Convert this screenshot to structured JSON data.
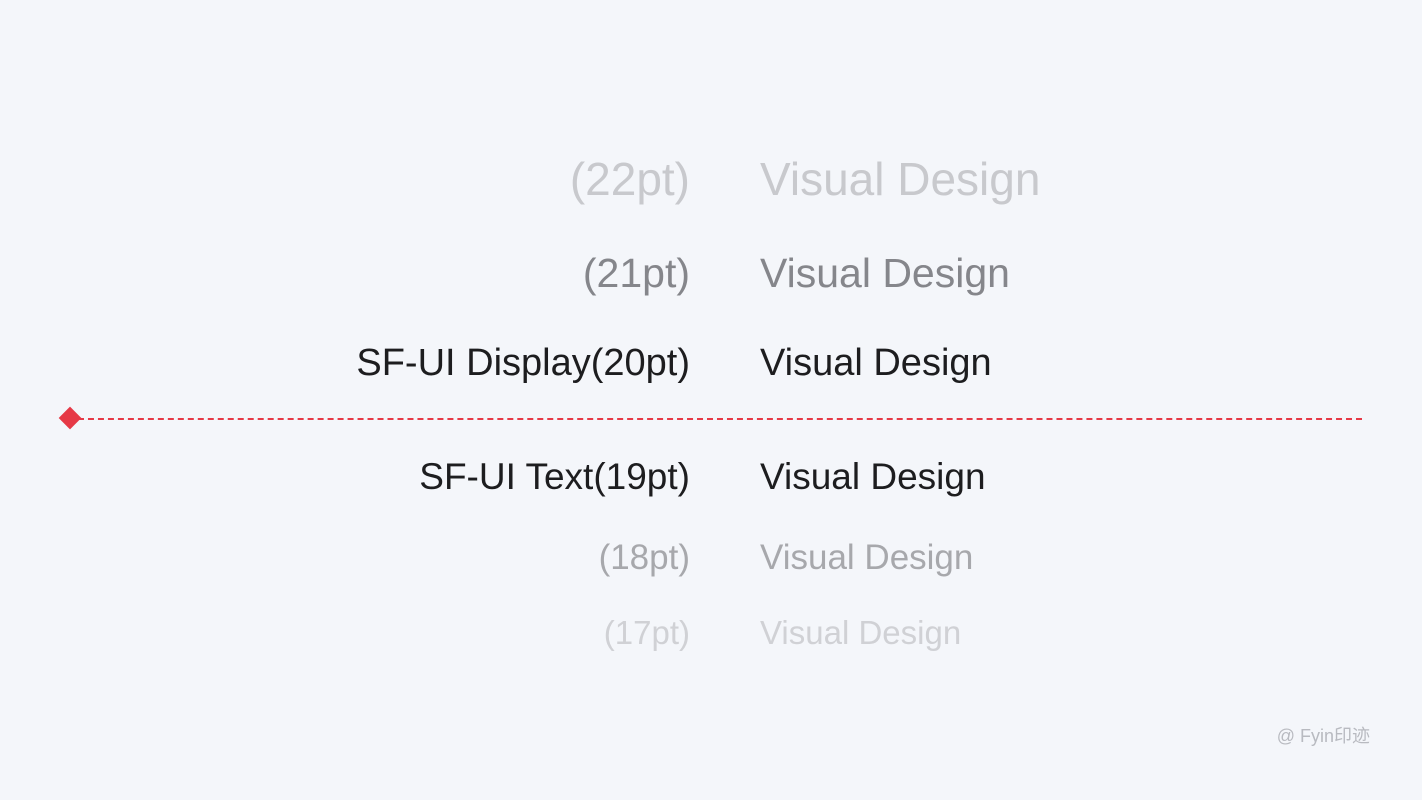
{
  "rows": {
    "r22": {
      "label": "(22pt)",
      "sample": "Visual Design"
    },
    "r21": {
      "label": "(21pt)",
      "sample": "Visual Design"
    },
    "r20": {
      "label": "SF-UI Display(20pt)",
      "sample": "Visual Design"
    },
    "r19": {
      "label": "SF-UI Text(19pt)",
      "sample": "Visual Design"
    },
    "r18": {
      "label": "(18pt)",
      "sample": "Visual Design"
    },
    "r17": {
      "label": "(17pt)",
      "sample": "Visual Design"
    }
  },
  "watermark": "@ Fyin印迹",
  "divider_color": "#e63946"
}
